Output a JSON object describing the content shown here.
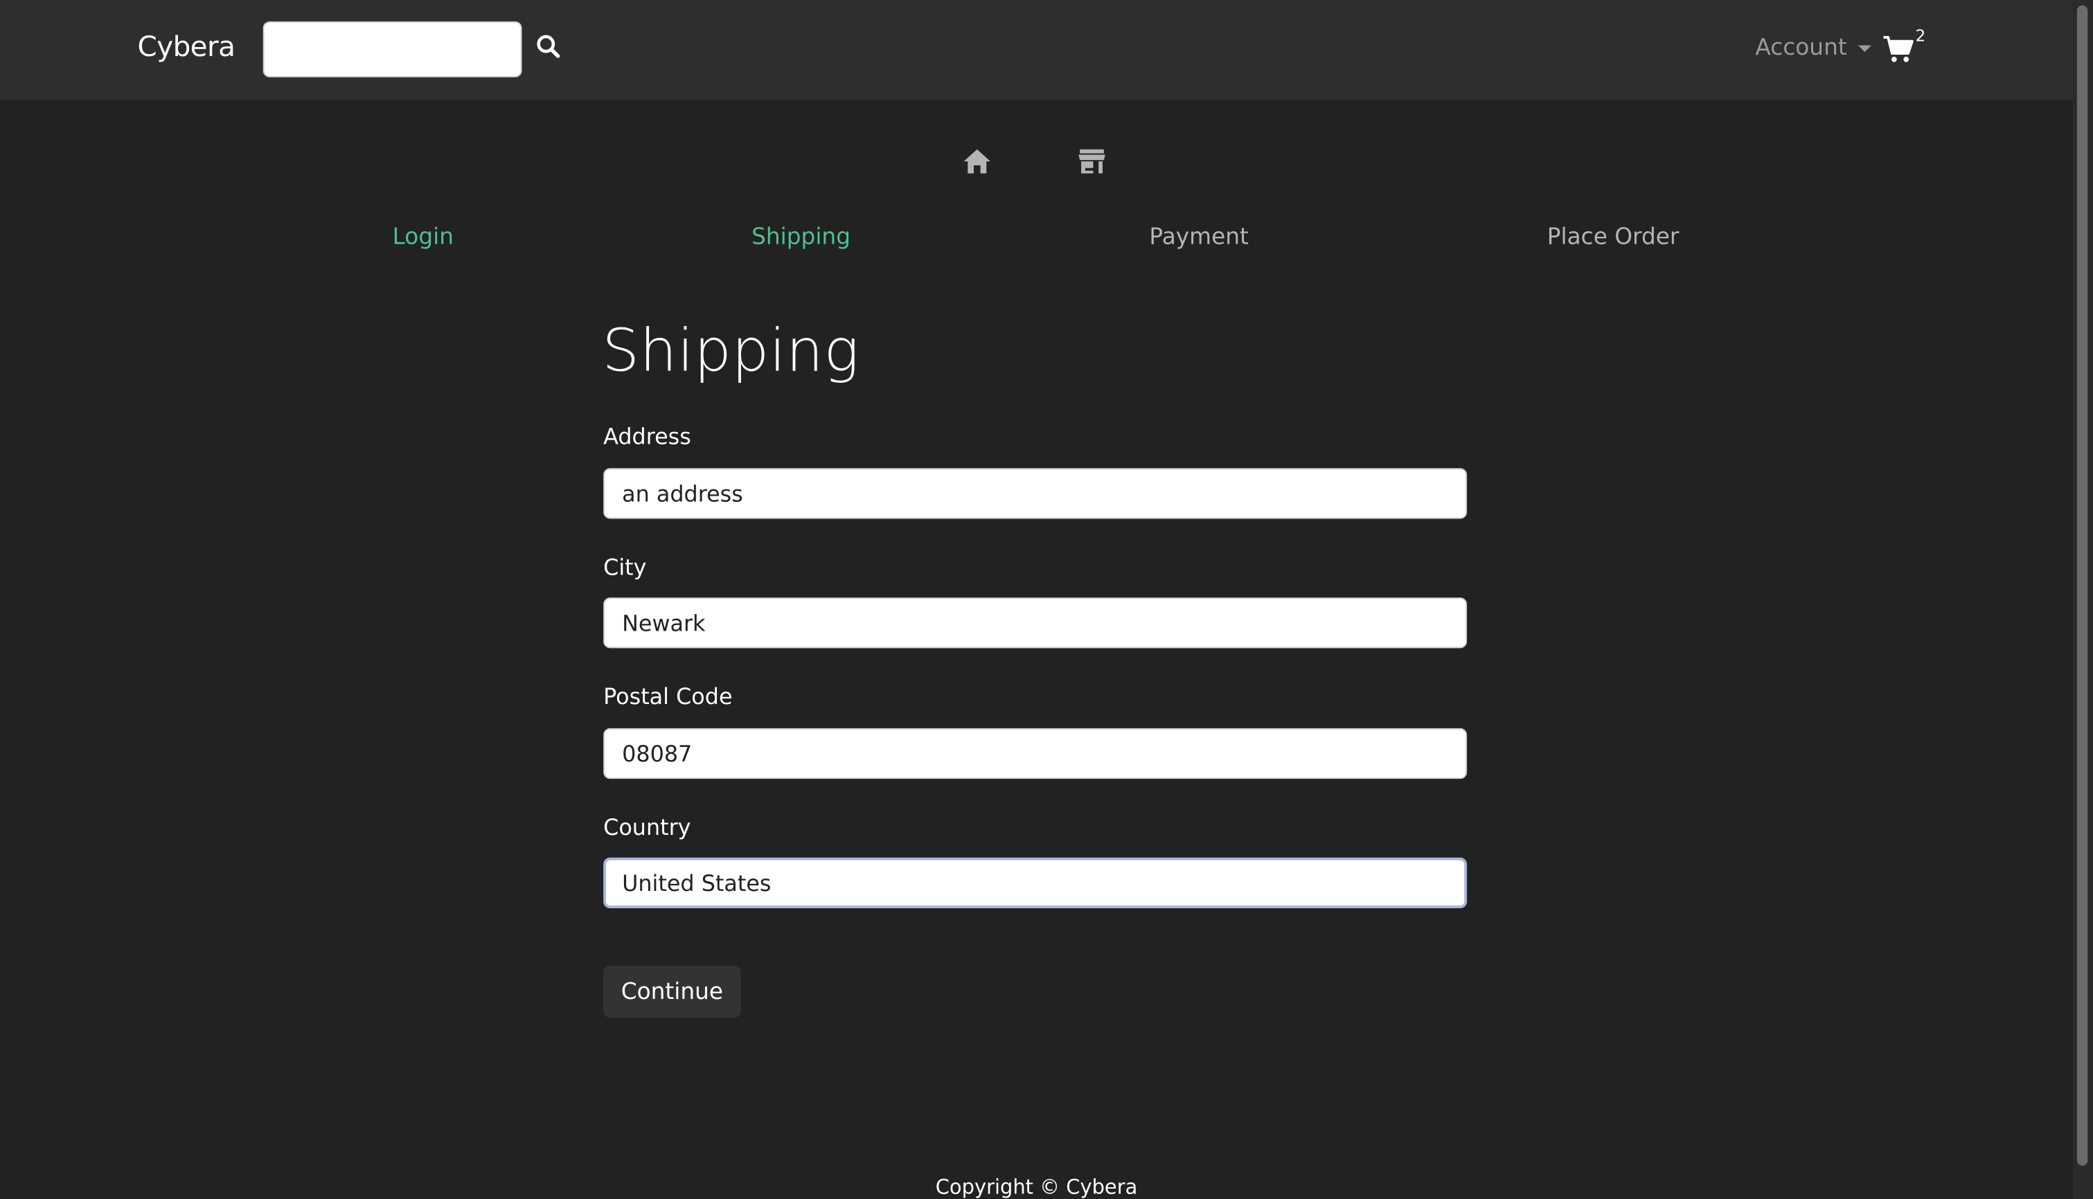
{
  "navbar": {
    "brand": "Cybera",
    "search_placeholder": "",
    "search_value": "",
    "account_label": "Account",
    "cart_count": "2"
  },
  "steps": [
    {
      "label": "Login",
      "state": "active"
    },
    {
      "label": "Shipping",
      "state": "active"
    },
    {
      "label": "Payment",
      "state": "inactive"
    },
    {
      "label": "Place Order",
      "state": "inactive"
    }
  ],
  "form": {
    "title": "Shipping",
    "address": {
      "label": "Address",
      "value": "an address"
    },
    "city": {
      "label": "City",
      "value": "Newark"
    },
    "postal_code": {
      "label": "Postal Code",
      "value": "08087"
    },
    "country": {
      "label": "Country",
      "value": "United States"
    },
    "submit_label": "Continue"
  },
  "footer": {
    "text": "Copyright © Cybera"
  },
  "colors": {
    "background": "#222222",
    "navbar": "#2e2e2e",
    "active_step": "#4fbf8f",
    "inactive_step": "#b5b5b5"
  },
  "icons": {
    "search": "search-icon",
    "cart": "cart-icon",
    "home": "home-icon",
    "store": "store-icon"
  }
}
